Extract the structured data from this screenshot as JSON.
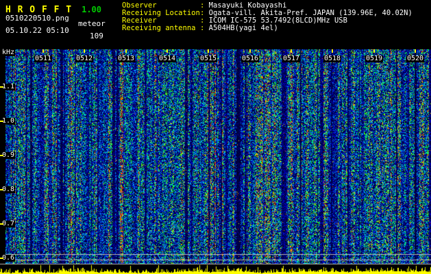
{
  "app": {
    "title": "H R O F F T",
    "version": "1.00",
    "filename": "0510220510.png",
    "mode": "meteor",
    "datetime": "05.10.22 05:10",
    "count": "109"
  },
  "station": {
    "separator": ": ",
    "rows": [
      {
        "label": "Observer",
        "value": "Masayuki Kobayashi"
      },
      {
        "label": "Receiving Location",
        "value": "Ogata-vill. Akita-Pref. JAPAN (139.96E, 40.02N)"
      },
      {
        "label": "Receiver",
        "value": "ICOM IC-575 53.7492(8LCD)MHz USB"
      },
      {
        "label": "Receiving antenna",
        "value": "A504HB(yagi 4el)"
      }
    ]
  },
  "spectrogram": {
    "freq_unit": "kHz",
    "freq_ticks": [
      "1.1",
      "1.0",
      "0.9",
      "0.8",
      "0.7",
      "0.6"
    ],
    "time_ticks": [
      "0511",
      "0512",
      "0513",
      "0514",
      "0515",
      "0516",
      "0517",
      "0518",
      "0519",
      "0520"
    ]
  },
  "colors": {
    "background": "#000000",
    "title": "#ffff00",
    "version": "#00cc00",
    "text": "#ffffff",
    "labels": "#ffff00",
    "trace": "#ffff00",
    "noise_base": "#000060",
    "noise_mid": "#0080ff",
    "noise_hot": "#ffff00"
  }
}
